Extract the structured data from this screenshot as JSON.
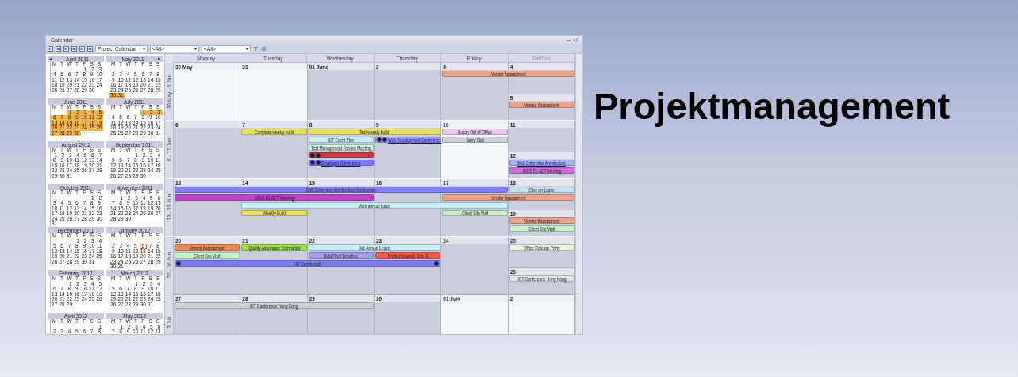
{
  "slide_title": "Projektmanagement",
  "window": {
    "title": "Calendar"
  },
  "toolbar": {
    "dropdowns": [
      {
        "value": "Project Calendar"
      },
      {
        "value": "<All>"
      },
      {
        "value": "<All>"
      }
    ]
  },
  "mini_calendars": [
    {
      "title": "April 2011",
      "prev": "◂",
      "weekdays": [
        "M",
        "T",
        "W",
        "T",
        "F",
        "S",
        "S"
      ],
      "weeks": [
        {
          "days": [
            "1",
            "2",
            "3"
          ],
          "highlighted": false
        },
        {
          "days": [
            "4",
            "5",
            "6",
            "7",
            "8",
            "9",
            "10"
          ],
          "highlighted": false
        },
        {
          "days": [
            "11",
            "12",
            "13",
            "14",
            "15",
            "16",
            "17"
          ],
          "highlighted": false
        },
        {
          "days": [
            "18",
            "19",
            "20",
            "21",
            "22",
            "23",
            "24"
          ],
          "highlighted": false
        },
        {
          "days": [
            "25",
            "26",
            "27",
            "28",
            "29",
            "30"
          ],
          "highlighted": false
        }
      ]
    },
    {
      "title": "May 2011",
      "next": "▸",
      "weekdays": [
        "M",
        "T",
        "W",
        "T",
        "F",
        "S",
        "S"
      ],
      "weeks": [
        {
          "days": [
            "1"
          ],
          "highlighted": false
        },
        {
          "days": [
            "2",
            "3",
            "4",
            "5",
            "6",
            "7",
            "8"
          ],
          "highlighted": false
        },
        {
          "days": [
            "9",
            "10",
            "11",
            "12",
            "13",
            "14",
            "15"
          ],
          "highlighted": false
        },
        {
          "days": [
            "16",
            "17",
            "18",
            "19",
            "20",
            "21",
            "22"
          ],
          "highlighted": false
        },
        {
          "days": [
            "23",
            "24",
            "25",
            "26",
            "27",
            "28",
            "29"
          ],
          "highlighted": false
        },
        {
          "days": [
            "30",
            "31"
          ],
          "highlighted": true
        }
      ]
    },
    {
      "title": "June 2011",
      "weekdays": [
        "M",
        "T",
        "W",
        "T",
        "F",
        "S",
        "S"
      ],
      "weeks": [
        {
          "days": [
            "1",
            "2",
            "3",
            "4",
            "5"
          ],
          "highlighted": true
        },
        {
          "days": [
            "6",
            "7",
            "8",
            "9",
            "10",
            "11",
            "12"
          ],
          "highlighted": true
        },
        {
          "days": [
            "13",
            "14",
            "15",
            "16",
            "17",
            "18",
            "19"
          ],
          "highlighted": true
        },
        {
          "days": [
            "20",
            "21",
            "22",
            "23",
            "24",
            "25",
            "26"
          ],
          "highlighted": true
        },
        {
          "days": [
            "27",
            "28",
            "29",
            "30"
          ],
          "highlighted": true
        }
      ]
    },
    {
      "title": "July 2011",
      "weekdays": [
        "M",
        "T",
        "W",
        "T",
        "F",
        "S",
        "S"
      ],
      "weeks": [
        {
          "days": [
            "1",
            "2",
            "3"
          ],
          "highlighted": true
        },
        {
          "days": [
            "4",
            "5",
            "6",
            "7",
            "8",
            "9",
            "10"
          ],
          "highlighted": false
        },
        {
          "days": [
            "11",
            "12",
            "13",
            "14",
            "15",
            "16",
            "17"
          ],
          "highlighted": false
        },
        {
          "days": [
            "18",
            "19",
            "20",
            "21",
            "22",
            "23",
            "24"
          ],
          "highlighted": false
        },
        {
          "days": [
            "25",
            "26",
            "27",
            "28",
            "29",
            "30",
            "31"
          ],
          "highlighted": false
        }
      ]
    },
    {
      "title": "August 2011",
      "weekdays": [
        "M",
        "T",
        "W",
        "T",
        "F",
        "S",
        "S"
      ],
      "weeks": [
        {
          "days": [
            "1",
            "2",
            "3",
            "4",
            "5",
            "6",
            "7"
          ],
          "highlighted": false
        },
        {
          "days": [
            "8",
            "9",
            "10",
            "11",
            "12",
            "13",
            "14"
          ],
          "highlighted": false
        },
        {
          "days": [
            "15",
            "16",
            "17",
            "18",
            "19",
            "20",
            "21"
          ],
          "highlighted": false
        },
        {
          "days": [
            "22",
            "23",
            "24",
            "25",
            "26",
            "27",
            "28"
          ],
          "highlighted": false
        },
        {
          "days": [
            "29",
            "30",
            "31"
          ],
          "highlighted": false
        }
      ]
    },
    {
      "title": "September 2011",
      "weekdays": [
        "M",
        "T",
        "W",
        "T",
        "F",
        "S",
        "S"
      ],
      "weeks": [
        {
          "days": [
            "1",
            "2",
            "3",
            "4"
          ],
          "highlighted": false
        },
        {
          "days": [
            "5",
            "6",
            "7",
            "8",
            "9",
            "10",
            "11"
          ],
          "highlighted": false
        },
        {
          "days": [
            "12",
            "13",
            "14",
            "15",
            "16",
            "17",
            "18"
          ],
          "highlighted": false
        },
        {
          "days": [
            "19",
            "20",
            "21",
            "22",
            "23",
            "24",
            "25"
          ],
          "highlighted": false
        },
        {
          "days": [
            "26",
            "27",
            "28",
            "29",
            "30"
          ],
          "highlighted": false
        }
      ]
    },
    {
      "title": "October 2011",
      "weekdays": [
        "M",
        "T",
        "W",
        "T",
        "F",
        "S",
        "S"
      ],
      "weeks": [
        {
          "days": [
            "1",
            "2"
          ],
          "highlighted": false
        },
        {
          "days": [
            "3",
            "4",
            "5",
            "6",
            "7",
            "8",
            "9"
          ],
          "highlighted": false
        },
        {
          "days": [
            "10",
            "11",
            "12",
            "13",
            "14",
            "15",
            "16"
          ],
          "highlighted": false
        },
        {
          "days": [
            "17",
            "18",
            "19",
            "20",
            "21",
            "22",
            "23"
          ],
          "highlighted": false
        },
        {
          "days": [
            "24",
            "25",
            "26",
            "27",
            "28",
            "29",
            "30"
          ],
          "highlighted": false
        },
        {
          "days": [
            "31"
          ],
          "highlighted": false
        }
      ]
    },
    {
      "title": "November 2011",
      "weekdays": [
        "M",
        "T",
        "W",
        "T",
        "F",
        "S",
        "S"
      ],
      "weeks": [
        {
          "days": [
            "1",
            "2",
            "3",
            "4",
            "5",
            "6"
          ],
          "highlighted": false
        },
        {
          "days": [
            "7",
            "8",
            "9",
            "10",
            "11",
            "12",
            "13"
          ],
          "highlighted": false
        },
        {
          "days": [
            "14",
            "15",
            "16",
            "17",
            "18",
            "19",
            "20"
          ],
          "highlighted": false
        },
        {
          "days": [
            "21",
            "22",
            "23",
            "24",
            "25",
            "26",
            "27"
          ],
          "highlighted": false
        },
        {
          "days": [
            "28",
            "29",
            "30"
          ],
          "highlighted": false
        }
      ]
    },
    {
      "title": "December 2011",
      "weekdays": [
        "M",
        "T",
        "W",
        "T",
        "F",
        "S",
        "S"
      ],
      "weeks": [
        {
          "days": [
            "1",
            "2",
            "3",
            "4"
          ],
          "highlighted": false
        },
        {
          "days": [
            "5",
            "6",
            "7",
            "8",
            "9",
            "10",
            "11"
          ],
          "highlighted": false
        },
        {
          "days": [
            "12",
            "13",
            "14",
            "15",
            "16",
            "17",
            "18"
          ],
          "highlighted": false
        },
        {
          "days": [
            "19",
            "20",
            "21",
            "22",
            "23",
            "24",
            "25"
          ],
          "highlighted": false
        },
        {
          "days": [
            "26",
            "27",
            "28",
            "29",
            "30",
            "31"
          ],
          "highlighted": false
        }
      ]
    },
    {
      "title": "January 2012",
      "weekdays": [
        "M",
        "T",
        "W",
        "T",
        "F",
        "S",
        "S"
      ],
      "weeks": [
        {
          "days": [
            "1"
          ],
          "highlighted": false
        },
        {
          "days": [
            "2",
            "3",
            "4",
            "5",
            {
              "text": "6",
              "today": true
            },
            "7",
            "8"
          ],
          "highlighted": false
        },
        {
          "days": [
            "9",
            "10",
            "11",
            "12",
            "13",
            "14",
            "15"
          ],
          "highlighted": false
        },
        {
          "days": [
            "16",
            "17",
            "18",
            "19",
            "20",
            "21",
            "22"
          ],
          "highlighted": false
        },
        {
          "days": [
            "23",
            "24",
            "25",
            "26",
            "27",
            "28",
            "29"
          ],
          "highlighted": false
        },
        {
          "days": [
            "30",
            "31"
          ],
          "highlighted": false
        }
      ]
    },
    {
      "title": "February 2012",
      "weekdays": [
        "M",
        "T",
        "W",
        "T",
        "F",
        "S",
        "S"
      ],
      "weeks": [
        {
          "days": [
            "1",
            "2",
            "3",
            "4",
            "5"
          ],
          "highlighted": false
        },
        {
          "days": [
            "6",
            "7",
            "8",
            "9",
            "10",
            "11",
            "12"
          ],
          "highlighted": false
        },
        {
          "days": [
            "13",
            "14",
            "15",
            "16",
            "17",
            "18",
            "19"
          ],
          "highlighted": false
        },
        {
          "days": [
            "20",
            "21",
            "22",
            "23",
            "24",
            "25",
            "26"
          ],
          "highlighted": false
        },
        {
          "days": [
            "27",
            "28",
            "29"
          ],
          "highlighted": false
        }
      ]
    },
    {
      "title": "March 2012",
      "weekdays": [
        "M",
        "T",
        "W",
        "T",
        "F",
        "S",
        "S"
      ],
      "weeks": [
        {
          "days": [
            "1",
            "2",
            "3",
            "4"
          ],
          "highlighted": false
        },
        {
          "days": [
            "5",
            "6",
            "7",
            "8",
            "9",
            "10",
            "11"
          ],
          "highlighted": false
        },
        {
          "days": [
            "12",
            "13",
            "14",
            "15",
            "16",
            "17",
            "18"
          ],
          "highlighted": false
        },
        {
          "days": [
            "19",
            "20",
            "21",
            "22",
            "23",
            "24",
            "25"
          ],
          "highlighted": false
        },
        {
          "days": [
            "26",
            "27",
            "28",
            "29",
            "30",
            "31"
          ],
          "highlighted": false
        }
      ]
    },
    {
      "title": "April 2012",
      "weekdays": [
        "M",
        "T",
        "W",
        "T",
        "F",
        "S",
        "S"
      ],
      "weeks": [
        {
          "days": [
            "1"
          ],
          "highlighted": false
        },
        {
          "days": [
            "2",
            "3",
            "4",
            "5",
            "6",
            "7",
            "8"
          ],
          "highlighted": false
        }
      ]
    },
    {
      "title": "May 2012",
      "weekdays": [
        "M",
        "T",
        "W",
        "T",
        "F",
        "S",
        "S"
      ],
      "weeks": [
        {
          "days": [
            "1",
            "2",
            "3",
            "4",
            "5",
            "6"
          ],
          "highlighted": false
        },
        {
          "days": [
            "7",
            "8",
            "9",
            "10",
            "11",
            "12",
            "13"
          ],
          "highlighted": false
        }
      ]
    }
  ],
  "column_headers": [
    {
      "label": "Monday"
    },
    {
      "label": "Tuesday"
    },
    {
      "label": "Wednesday"
    },
    {
      "label": "Thursday"
    },
    {
      "label": "Friday"
    },
    {
      "label": "Sat/Sun"
    }
  ],
  "weeks": [
    {
      "label": "30 May - 5 Jun",
      "days": [
        {
          "date": "30 May",
          "highlighted": true
        },
        {
          "date": "31",
          "highlighted": true
        },
        {
          "date": "01 June",
          "highlighted": false
        },
        {
          "date": "2",
          "highlighted": false
        },
        {
          "date": "3",
          "highlighted": false
        },
        {
          "date": "4",
          "highlighted": false
        }
      ],
      "lanes": [
        [
          {
            "kind": "gap"
          },
          {
            "kind": "gap"
          },
          {
            "kind": "gap"
          },
          {
            "kind": "gap"
          },
          {
            "kind": "event",
            "title": "Vendor Assessment",
            "color": "#eca488"
          },
          {
            "kind": "continued"
          }
        ]
      ],
      "sunday": {
        "date": "5",
        "highlighted": false,
        "events": [
          {
            "title": "Vendor Assessment",
            "color": "#eca488"
          }
        ]
      }
    },
    {
      "label": "6 - 12 Jun",
      "days": [
        {
          "date": "6",
          "highlighted": false
        },
        {
          "date": "7",
          "highlighted": false
        },
        {
          "date": "8",
          "highlighted": false
        },
        {
          "date": "9",
          "highlighted": false
        },
        {
          "date": "10",
          "highlighted": true
        },
        {
          "date": "11",
          "highlighted": false
        }
      ],
      "lanes": [
        [
          {
            "kind": "gap"
          },
          {
            "kind": "event",
            "title": "Complete weekly build",
            "color": "#e8e060"
          },
          {
            "kind": "event",
            "title": "Test weekly build",
            "color": "#e8e060"
          },
          {
            "kind": "continued"
          },
          {
            "kind": "event",
            "title": "Susan Out of Office",
            "color": "#e8c8ec"
          }
        ],
        [
          {
            "kind": "gap"
          },
          {
            "kind": "gap"
          },
          {
            "kind": "event",
            "title": "ICT Event Plan",
            "color": "#c8f0f4"
          },
          {
            "kind": "event",
            "title": "Web Development Conference",
            "color": "#9a9cf0",
            "linked": true,
            "lead_icons": [
              {
                "kind": "circle"
              },
              {
                "kind": "circle"
              }
            ]
          },
          {
            "kind": "event",
            "title": "Barry Sick",
            "color": "#d0d2da"
          }
        ],
        [
          {
            "kind": "gap"
          },
          {
            "kind": "gap"
          },
          {
            "kind": "event",
            "title": "Test Management Review Meeting",
            "color": "#d4f4e4"
          }
        ],
        [
          {
            "kind": "gap"
          },
          {
            "kind": "gap"
          },
          {
            "kind": "event",
            "color": "#c83c3c",
            "lead_icons": [
              {
                "kind": "circle"
              },
              {
                "kind": "circle"
              }
            ]
          }
        ],
        [
          {
            "kind": "gap"
          },
          {
            "kind": "gap"
          },
          {
            "kind": "event",
            "title": "Developer Conference",
            "color": "#7c7cf4",
            "linked": true,
            "lead_icons": [
              {
                "kind": "circle"
              },
              {
                "kind": "circle"
              }
            ]
          }
        ]
      ],
      "sunday": {
        "date": "12",
        "highlighted": false,
        "events": [
          {
            "title": "Web Enterprise Architecture",
            "color": "#a8b4f0",
            "linked": true
          },
          {
            "title": "UIDS EL AET Meeting",
            "color": "#d070d8"
          }
        ]
      }
    },
    {
      "label": "13 - 19 Jun",
      "days": [
        {
          "date": "13",
          "highlighted": false
        },
        {
          "date": "14",
          "highlighted": false
        },
        {
          "date": "15",
          "highlighted": false
        },
        {
          "date": "16",
          "highlighted": false
        },
        {
          "date": "17",
          "highlighted": false
        },
        {
          "date": "18",
          "highlighted": false
        }
      ],
      "lanes": [
        [
          {
            "kind": "event",
            "title": "DoD Enterprise Architecture Conference",
            "color": "#8080f0"
          },
          {
            "kind": "continued"
          },
          {
            "kind": "continued"
          },
          {
            "kind": "continued"
          },
          {
            "kind": "continued"
          },
          {
            "kind": "event",
            "title": "Clive on Leave",
            "color": "#c8e0f4"
          }
        ],
        [
          {
            "kind": "event",
            "title": "UIDS EL AET Meeting",
            "color": "#c040c8"
          },
          {
            "kind": "continued"
          },
          {
            "kind": "continued"
          },
          {
            "kind": "gap"
          },
          {
            "kind": "event",
            "title": "Vendor Assessment",
            "color": "#eca488"
          },
          {
            "kind": "continued"
          }
        ],
        [
          {
            "kind": "gap"
          },
          {
            "kind": "event",
            "title": "Mark annual leave",
            "color": "#c8f0f4"
          },
          {
            "kind": "continued"
          },
          {
            "kind": "continued"
          },
          {
            "kind": "continued"
          }
        ],
        [
          {
            "kind": "gap"
          },
          {
            "kind": "event",
            "title": "Weekly Build",
            "color": "#e8e060"
          },
          {
            "kind": "gap"
          },
          {
            "kind": "gap"
          },
          {
            "kind": "event",
            "title": "Client Site Visit",
            "color": "#c8f0cc"
          }
        ]
      ],
      "sunday": {
        "date": "19",
        "highlighted": false,
        "events": [
          {
            "title": "Vendor Assessment",
            "color": "#eca488"
          },
          {
            "title": "Client Site Visit",
            "color": "#c8f0cc"
          }
        ]
      }
    },
    {
      "label": "20 - 26 Jun",
      "days": [
        {
          "date": "20",
          "highlighted": false
        },
        {
          "date": "21",
          "highlighted": false
        },
        {
          "date": "22",
          "highlighted": false
        },
        {
          "date": "23",
          "highlighted": false
        },
        {
          "date": "24",
          "highlighted": false
        },
        {
          "date": "25",
          "highlighted": false
        }
      ],
      "lanes": [
        [
          {
            "kind": "event",
            "title": "Vendor Assessment",
            "color": "#f08850"
          },
          {
            "kind": "event",
            "title": "Quality Assurance Completed",
            "color": "#a0e048"
          },
          {
            "kind": "event",
            "title": "Joe Annual Leave",
            "color": "#c8f0f4"
          },
          {
            "kind": "continued"
          },
          {
            "kind": "gap"
          },
          {
            "kind": "event",
            "title": "Office Release Party",
            "color": "#f0f0dc"
          }
        ],
        [
          {
            "kind": "event",
            "title": "Client Site Visit",
            "color": "#c8f4cc"
          },
          {
            "kind": "gap"
          },
          {
            "kind": "event",
            "title": "Beta Final Deadline",
            "color": "#a0a0f0"
          },
          {
            "kind": "event",
            "title": "Product Launch Beta 2",
            "color": "#f05848"
          }
        ],
        [
          {
            "kind": "event",
            "title": "HR Conference",
            "color": "#7c7cf4",
            "lead_icons": [
              {
                "kind": "circle"
              }
            ],
            "trail_icons": [
              {
                "kind": "circle"
              }
            ]
          },
          {
            "kind": "continued"
          },
          {
            "kind": "continued"
          },
          {
            "kind": "continued"
          }
        ]
      ],
      "sunday": {
        "date": "26",
        "highlighted": false,
        "events": [
          {
            "title": "ICT Conference Hong Kong",
            "color": "#e4e6ec"
          }
        ]
      }
    },
    {
      "label": "3 Jul",
      "days": [
        {
          "date": "27",
          "highlighted": false
        },
        {
          "date": "28",
          "highlighted": false
        },
        {
          "date": "29",
          "highlighted": false
        },
        {
          "date": "30",
          "highlighted": false
        },
        {
          "date": "01 July",
          "highlighted": true
        },
        {
          "date": "2",
          "highlighted": true
        }
      ],
      "lanes": [
        [
          {
            "kind": "event",
            "title": "ICT Conference Hong Kong",
            "color": "#d0d2da"
          },
          {
            "kind": "continued"
          },
          {
            "kind": "continued"
          }
        ]
      ]
    }
  ]
}
